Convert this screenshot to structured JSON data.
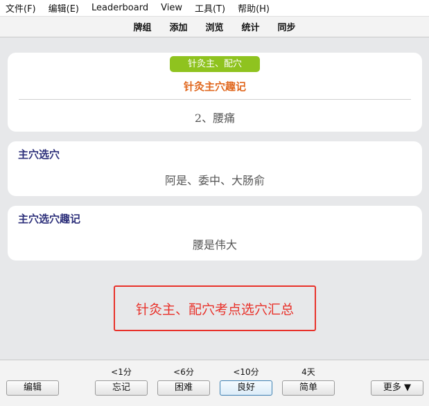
{
  "menu": [
    "文件(F)",
    "编辑(E)",
    "Leaderboard",
    "View",
    "工具(T)",
    "帮助(H)"
  ],
  "toolbar": [
    "牌组",
    "添加",
    "浏览",
    "统计",
    "同步"
  ],
  "card": {
    "tag": "针灸主、配穴",
    "mnemonic_title": "针灸主穴趣记",
    "topic": "2、腰痛",
    "field1_label": "主穴选穴",
    "field1_value": "阿是、委中、大肠俞",
    "field2_label": "主穴选穴趣记",
    "field2_value": "腰是伟大"
  },
  "highlight": "针灸主、配穴考点选穴汇总",
  "bottom": {
    "edit": "编辑",
    "more": "更多 ▼",
    "answers": [
      {
        "interval": "<1分",
        "label": "忘记"
      },
      {
        "interval": "<6分",
        "label": "困难"
      },
      {
        "interval": "<10分",
        "label": "良好"
      },
      {
        "interval": "4天",
        "label": "简单"
      }
    ]
  }
}
